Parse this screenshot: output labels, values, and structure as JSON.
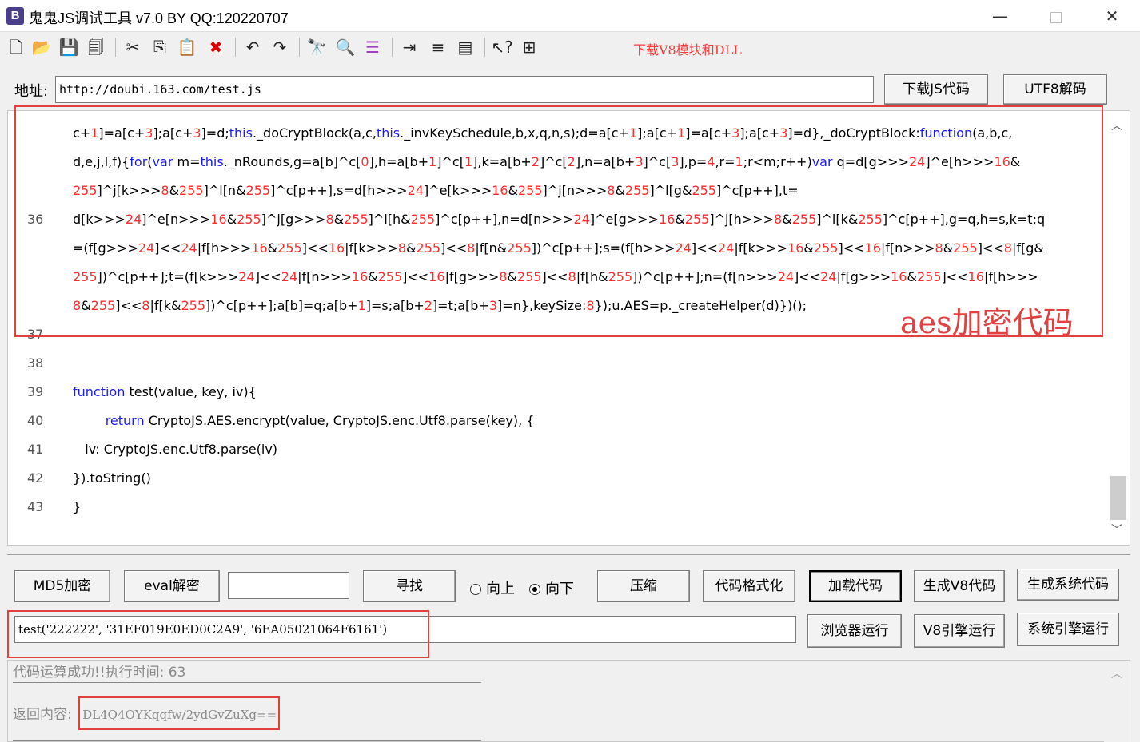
{
  "window": {
    "app_icon": "B",
    "title": "鬼鬼JS调试工具 v7.0 BY QQ:120220707",
    "minimize": "—",
    "close": "✕"
  },
  "toolbar": {
    "icons": [
      "new-file-icon",
      "open-folder-icon",
      "save-icon",
      "save-all-icon",
      "cut-icon",
      "copy-icon",
      "paste-icon",
      "delete-icon",
      "undo-icon",
      "redo-icon",
      "find-icon",
      "find-replace-icon",
      "list-icon",
      "indent-icon",
      "numbered-list-icon",
      "window-icon",
      "help-icon",
      "bookmark-icon"
    ],
    "download_link": "下载V8模块和DLL"
  },
  "address": {
    "label": "地址:",
    "value": "http://doubi.163.com/test.js",
    "download_js_button": "下载JS代码",
    "utf8_decode_button": "UTF8解码"
  },
  "editor": {
    "lines": [
      {
        "num": "36",
        "segments": [
          [
            "c+",
            ""
          ],
          [
            "1",
            "num"
          ],
          [
            "]=a[c+",
            ""
          ],
          [
            "3",
            "num"
          ],
          [
            "];a[c+",
            ""
          ],
          [
            "3",
            "num"
          ],
          [
            "]=d;",
            ""
          ],
          [
            "this",
            "kw"
          ],
          [
            "._doCryptBlock(a,c,",
            ""
          ],
          [
            "this",
            "kw"
          ],
          [
            "._invKeySchedule,b,x,q,n,s);d=a[c+",
            ""
          ],
          [
            "1",
            "num"
          ],
          [
            "];a[c+",
            ""
          ],
          [
            "1",
            "num"
          ],
          [
            "]=a[c+",
            ""
          ],
          [
            "3",
            "num"
          ],
          [
            "];a[c+",
            ""
          ],
          [
            "3",
            "num"
          ],
          [
            "]=d},_doCryptBlock:",
            ""
          ],
          [
            "function",
            "kw"
          ],
          [
            "(a,b,c,",
            ""
          ]
        ]
      },
      {
        "num": "",
        "segments": [
          [
            "d,e,j,l,f){",
            ""
          ],
          [
            "for",
            "kw"
          ],
          [
            "(",
            ""
          ],
          [
            "var",
            "kw"
          ],
          [
            " m=",
            ""
          ],
          [
            "this",
            "kw"
          ],
          [
            "._nRounds,g=a[b]^c[",
            ""
          ],
          [
            "0",
            "num"
          ],
          [
            "],h=a[b+",
            ""
          ],
          [
            "1",
            "num"
          ],
          [
            "]^c[",
            ""
          ],
          [
            "1",
            "num"
          ],
          [
            "],k=a[b+",
            ""
          ],
          [
            "2",
            "num"
          ],
          [
            "]^c[",
            ""
          ],
          [
            "2",
            "num"
          ],
          [
            "],n=a[b+",
            ""
          ],
          [
            "3",
            "num"
          ],
          [
            "]^c[",
            ""
          ],
          [
            "3",
            "num"
          ],
          [
            "],p=",
            ""
          ],
          [
            "4",
            "num"
          ],
          [
            ",r=",
            ""
          ],
          [
            "1",
            "num"
          ],
          [
            ";r<m;r++)",
            ""
          ],
          [
            "var",
            "kw"
          ],
          [
            " q=d[g>>>",
            ""
          ],
          [
            "24",
            "num"
          ],
          [
            "]^e[h>>>",
            ""
          ],
          [
            "16",
            "num"
          ],
          [
            "&",
            ""
          ]
        ]
      },
      {
        "num": "",
        "segments": [
          [
            "255",
            "num"
          ],
          [
            "]^j[k>>>",
            ""
          ],
          [
            "8",
            "num"
          ],
          [
            "&",
            ""
          ],
          [
            "255",
            "num"
          ],
          [
            "]^l[n&",
            ""
          ],
          [
            "255",
            "num"
          ],
          [
            "]^c[p++],s=d[h>>>",
            ""
          ],
          [
            "24",
            "num"
          ],
          [
            "]^e[k>>>",
            ""
          ],
          [
            "16",
            "num"
          ],
          [
            "&",
            ""
          ],
          [
            "255",
            "num"
          ],
          [
            "]^j[n>>>",
            ""
          ],
          [
            "8",
            "num"
          ],
          [
            "&",
            ""
          ],
          [
            "255",
            "num"
          ],
          [
            "]^l[g&",
            ""
          ],
          [
            "255",
            "num"
          ],
          [
            "]^c[p++],t=",
            ""
          ]
        ]
      },
      {
        "num": "",
        "segments": [
          [
            "d[k>>>",
            ""
          ],
          [
            "24",
            "num"
          ],
          [
            "]^e[n>>>",
            ""
          ],
          [
            "16",
            "num"
          ],
          [
            "&",
            ""
          ],
          [
            "255",
            "num"
          ],
          [
            "]^j[g>>>",
            ""
          ],
          [
            "8",
            "num"
          ],
          [
            "&",
            ""
          ],
          [
            "255",
            "num"
          ],
          [
            "]^l[h&",
            ""
          ],
          [
            "255",
            "num"
          ],
          [
            "]^c[p++],n=d[n>>>",
            ""
          ],
          [
            "24",
            "num"
          ],
          [
            "]^e[g>>>",
            ""
          ],
          [
            "16",
            "num"
          ],
          [
            "&",
            ""
          ],
          [
            "255",
            "num"
          ],
          [
            "]^j[h>>>",
            ""
          ],
          [
            "8",
            "num"
          ],
          [
            "&",
            ""
          ],
          [
            "255",
            "num"
          ],
          [
            "]^l[k&",
            ""
          ],
          [
            "255",
            "num"
          ],
          [
            "]^c[p++],g=q,h=s,k=t;q",
            ""
          ]
        ]
      },
      {
        "num": "",
        "segments": [
          [
            "=(f[g>>>",
            ""
          ],
          [
            "24",
            "num"
          ],
          [
            "]<<",
            ""
          ],
          [
            "24",
            "num"
          ],
          [
            "|f[h>>>",
            ""
          ],
          [
            "16",
            "num"
          ],
          [
            "&",
            ""
          ],
          [
            "255",
            "num"
          ],
          [
            "]<<",
            ""
          ],
          [
            "16",
            "num"
          ],
          [
            "|f[k>>>",
            ""
          ],
          [
            "8",
            "num"
          ],
          [
            "&",
            ""
          ],
          [
            "255",
            "num"
          ],
          [
            "]<<",
            ""
          ],
          [
            "8",
            "num"
          ],
          [
            "|f[n&",
            ""
          ],
          [
            "255",
            "num"
          ],
          [
            "])^c[p++];s=(f[h>>>",
            ""
          ],
          [
            "24",
            "num"
          ],
          [
            "]<<",
            ""
          ],
          [
            "24",
            "num"
          ],
          [
            "|f[k>>>",
            ""
          ],
          [
            "16",
            "num"
          ],
          [
            "&",
            ""
          ],
          [
            "255",
            "num"
          ],
          [
            "]<<",
            ""
          ],
          [
            "16",
            "num"
          ],
          [
            "|f[n>>>",
            ""
          ],
          [
            "8",
            "num"
          ],
          [
            "&",
            ""
          ],
          [
            "255",
            "num"
          ],
          [
            "]<<",
            ""
          ],
          [
            "8",
            "num"
          ],
          [
            "|f[g&",
            ""
          ]
        ]
      },
      {
        "num": "",
        "segments": [
          [
            "255",
            "num"
          ],
          [
            "])^c[p++];t=(f[k>>>",
            ""
          ],
          [
            "24",
            "num"
          ],
          [
            "]<<",
            ""
          ],
          [
            "24",
            "num"
          ],
          [
            "|f[n>>>",
            ""
          ],
          [
            "16",
            "num"
          ],
          [
            "&",
            ""
          ],
          [
            "255",
            "num"
          ],
          [
            "]<<",
            ""
          ],
          [
            "16",
            "num"
          ],
          [
            "|f[g>>>",
            ""
          ],
          [
            "8",
            "num"
          ],
          [
            "&",
            ""
          ],
          [
            "255",
            "num"
          ],
          [
            "]<<",
            ""
          ],
          [
            "8",
            "num"
          ],
          [
            "|f[h&",
            ""
          ],
          [
            "255",
            "num"
          ],
          [
            "])^c[p++];n=(f[n>>>",
            ""
          ],
          [
            "24",
            "num"
          ],
          [
            "]<<",
            ""
          ],
          [
            "24",
            "num"
          ],
          [
            "|f[g>>>",
            ""
          ],
          [
            "16",
            "num"
          ],
          [
            "&",
            ""
          ],
          [
            "255",
            "num"
          ],
          [
            "]<<",
            ""
          ],
          [
            "16",
            "num"
          ],
          [
            "|f[h>>>",
            ""
          ]
        ]
      },
      {
        "num": "",
        "segments": [
          [
            "8",
            "num"
          ],
          [
            "&",
            ""
          ],
          [
            "255",
            "num"
          ],
          [
            "]<<",
            ""
          ],
          [
            "8",
            "num"
          ],
          [
            "|f[k&",
            ""
          ],
          [
            "255",
            "num"
          ],
          [
            "])^c[p++];a[b]=q;a[b+",
            ""
          ],
          [
            "1",
            "num"
          ],
          [
            "]=s;a[b+",
            ""
          ],
          [
            "2",
            "num"
          ],
          [
            "]=t;a[b+",
            ""
          ],
          [
            "3",
            "num"
          ],
          [
            "]=n},keySize:",
            ""
          ],
          [
            "8",
            "num"
          ],
          [
            "});u.AES=p._createHelper(d)})();",
            ""
          ]
        ]
      },
      {
        "num": "37",
        "segments": []
      },
      {
        "num": "38",
        "segments": []
      },
      {
        "num": "39",
        "segments": [
          [
            "function",
            "kw"
          ],
          [
            " test(value, key, iv){",
            ""
          ]
        ]
      },
      {
        "num": "40",
        "segments": [
          [
            "        ",
            ""
          ],
          [
            "return",
            "kw"
          ],
          [
            " CryptoJS.AES.encrypt(value, CryptoJS.enc.Utf8.parse(key), {",
            ""
          ]
        ]
      },
      {
        "num": "41",
        "segments": [
          [
            "   iv: CryptoJS.enc.Utf8.parse(iv)",
            ""
          ]
        ]
      },
      {
        "num": "42",
        "segments": [
          [
            "}).toString()",
            ""
          ]
        ]
      },
      {
        "num": "43",
        "segments": [
          [
            "}",
            ""
          ]
        ]
      }
    ],
    "annotation": "aes加密代码",
    "scroll_up": "︿",
    "scroll_down": "﹀"
  },
  "controls": {
    "md5_button": "MD5加密",
    "eval_decode_button": "eval解密",
    "search_value": "",
    "find_button": "寻找",
    "radio_up": "向上",
    "radio_down": "向下",
    "compress_button": "压缩",
    "format_button": "代码格式化",
    "load_code_button": "加载代码",
    "gen_v8_button": "生成V8代码",
    "gen_system_button": "生成系统代码",
    "command_value": "test('222222', '31EF019E0ED0C2A9', '6EA05021064F6161')",
    "browser_run_button": "浏览器运行",
    "v8_run_button": "V8引擎运行",
    "system_run_button": "系统引擎运行"
  },
  "result": {
    "status": "代码运算成功!!执行时间: 63",
    "return_label": "返回内容:",
    "return_value": "DL4Q4OYKqqfw/2ydGvZuXg=="
  },
  "colors": {
    "keyword": "#1919ff",
    "number": "#ff2b2b",
    "annotation": "#e24040",
    "download_link": "#ff3b3b"
  }
}
